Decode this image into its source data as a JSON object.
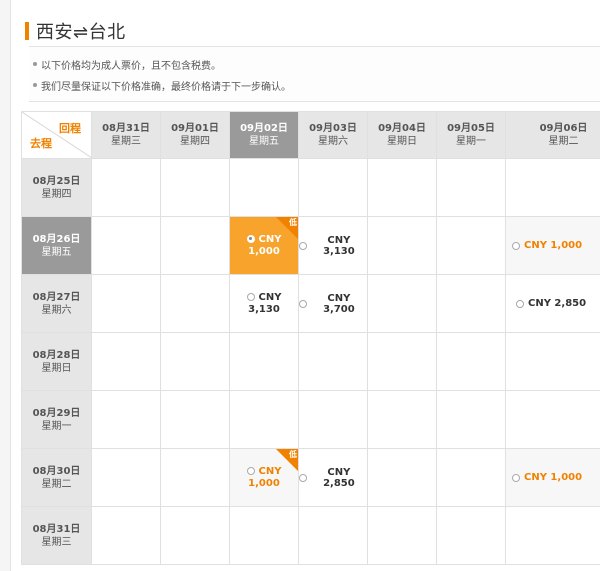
{
  "title": "西安⇌台北",
  "notes": [
    "以下价格均为成人票价，且不包含税费。",
    "我们尽量保证以下价格准确，最终价格请于下一步确认。"
  ],
  "corner": {
    "return_label": "回程",
    "depart_label": "去程"
  },
  "columns": [
    {
      "date": "08月31日",
      "weekday": "星期三"
    },
    {
      "date": "09月01日",
      "weekday": "星期四"
    },
    {
      "date": "09月02日",
      "weekday": "星期五"
    },
    {
      "date": "09月03日",
      "weekday": "星期六"
    },
    {
      "date": "09月04日",
      "weekday": "星期日"
    },
    {
      "date": "09月05日",
      "weekday": "星期一"
    },
    {
      "date": "09月06日",
      "weekday": "星期二"
    }
  ],
  "rows": [
    {
      "date": "08月25日",
      "weekday": "星期四"
    },
    {
      "date": "08月26日",
      "weekday": "星期五"
    },
    {
      "date": "08月27日",
      "weekday": "星期六"
    },
    {
      "date": "08月28日",
      "weekday": "星期日"
    },
    {
      "date": "08月29日",
      "weekday": "星期一"
    },
    {
      "date": "08月30日",
      "weekday": "星期二"
    },
    {
      "date": "08月31日",
      "weekday": "星期三"
    }
  ],
  "low_badge": "低",
  "prices": {
    "r1c2": {
      "line1": "CNY",
      "line2": "1,000"
    },
    "r1c3": "CNY 3,130",
    "r1c6": "CNY 1,000",
    "r2c2": {
      "line1": "CNY",
      "line2": "3,130"
    },
    "r2c3": "CNY 3,700",
    "r2c6": "CNY 2,850",
    "r5c2": {
      "line1": "CNY",
      "line2": "1,000"
    },
    "r5c3": "CNY 2,850",
    "r5c6": "CNY 1,000"
  },
  "colors": {
    "accent": "#f08200",
    "active_cell": "#f7a32c",
    "selected_header": "#9a9a9a"
  }
}
